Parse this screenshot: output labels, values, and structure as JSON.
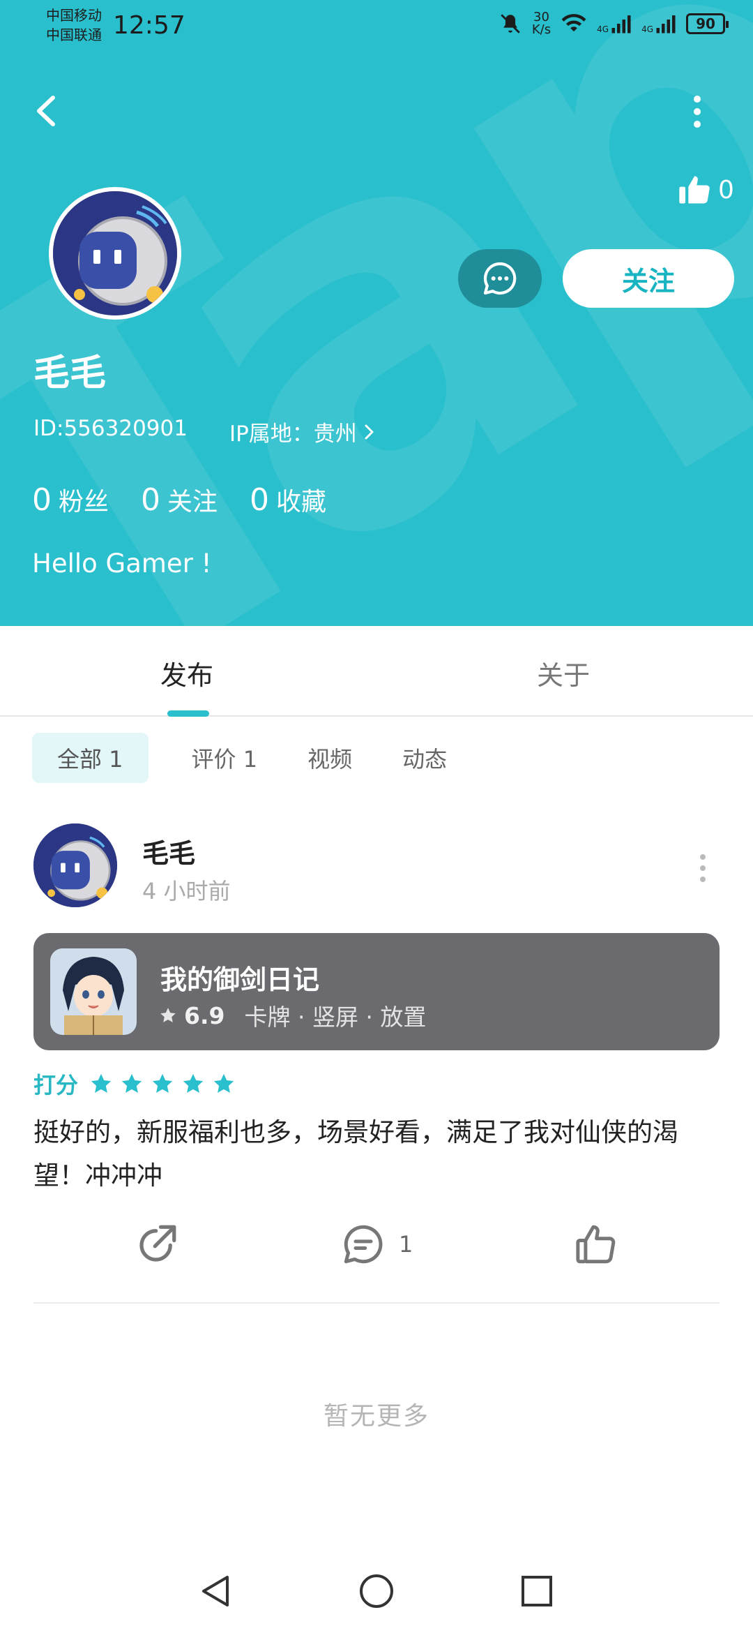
{
  "status_bar": {
    "carrier_1": "中国移动",
    "carrier_2": "中国联通",
    "time": "12:57",
    "speed_value": "30",
    "speed_unit": "K/s",
    "network_1": "4G",
    "network_2": "4G",
    "battery": "90"
  },
  "profile": {
    "likes": "0",
    "name": "毛毛",
    "id_text": "ID:556320901",
    "ip_text": "IP属地：贵州",
    "follow_label": "关注",
    "stats": [
      {
        "num": "0",
        "label": "粉丝"
      },
      {
        "num": "0",
        "label": "关注"
      },
      {
        "num": "0",
        "label": "收藏"
      }
    ],
    "bio": "Hello Gamer !"
  },
  "tabs": {
    "publish": "发布",
    "about": "关于"
  },
  "filters": [
    {
      "label": "全部 1",
      "active": true
    },
    {
      "label": "评价 1",
      "active": false
    },
    {
      "label": "视频",
      "active": false
    },
    {
      "label": "动态",
      "active": false
    }
  ],
  "post": {
    "author": "毛毛",
    "time": "4 小时前",
    "game": {
      "title": "我的御剑日记",
      "rating": "6.9",
      "tags": "卡牌 · 竖屏 · 放置"
    },
    "score_label": "打分",
    "stars": 5,
    "review": "挺好的，新服福利也多，场景好看，满足了我对仙侠的渴望！冲冲冲",
    "comment_count": "1"
  },
  "footer": {
    "end_text": "暂无更多"
  },
  "colors": {
    "header_bg": "#29bfcc",
    "accent": "#29bfcc",
    "card_bg": "#6b6a6e"
  }
}
